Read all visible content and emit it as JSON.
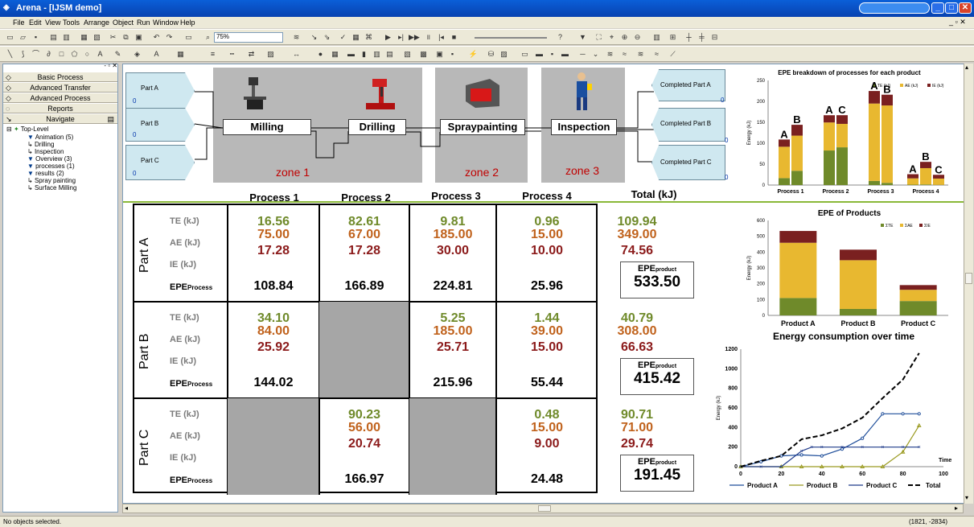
{
  "window": {
    "title": "Arena - [IJSM demo]"
  },
  "menu": [
    "File",
    "Edit",
    "View",
    "Tools",
    "Arrange",
    "Object",
    "Run",
    "Window",
    "Help"
  ],
  "toolbar": {
    "zoom": "75%"
  },
  "panels": [
    "Basic Process",
    "Advanced Transfer",
    "Advanced Process",
    "Reports",
    "Navigate"
  ],
  "tree": {
    "root": "Top-Level",
    "items": [
      "Animation (5)",
      "Drilling",
      "Inspection",
      "Overview (3)",
      "processes (1)",
      "results (2)",
      "Spray painting",
      "Surface Milling"
    ]
  },
  "model": {
    "parts": [
      {
        "label": "Part A",
        "count": "0"
      },
      {
        "label": "Part B",
        "count": "0"
      },
      {
        "label": "Part C",
        "count": "0"
      }
    ],
    "completed": [
      {
        "label": "Completed Part A",
        "count": "0"
      },
      {
        "label": "Completed Part B",
        "count": "0"
      },
      {
        "label": "Completed Part C",
        "count": "0"
      }
    ],
    "processes": [
      "Milling",
      "Drilling",
      "Spraypainting",
      "Inspection"
    ],
    "zones": [
      "zone 1",
      "zone 2",
      "zone 3"
    ]
  },
  "table": {
    "headers": [
      "Process 1",
      "Process 2",
      "Process 3",
      "Process 4",
      "Total  (kJ)"
    ],
    "row_labels": [
      "TE (kJ)",
      "AE (kJ)",
      "IE (kJ)"
    ],
    "epe_process": "EPE",
    "epe_process_sub": "Process",
    "epe_product": "EPE",
    "epe_product_sub": "product",
    "parts": [
      {
        "name": "Part A",
        "te": [
          "16.56",
          "82.61",
          "9.81",
          "0.96"
        ],
        "ae": [
          "75.00",
          "67.00",
          "185.00",
          "15.00"
        ],
        "ie": [
          "17.28",
          "17.28",
          "30.00",
          "10.00"
        ],
        "epe": [
          "108.84",
          "166.89",
          "224.81",
          "25.96"
        ],
        "total_te": "109.94",
        "total_ae": "349.00",
        "total_ie": "74.56",
        "total_epe": "533.50"
      },
      {
        "name": "Part B",
        "te": [
          "34.10",
          "",
          "5.25",
          "1.44"
        ],
        "ae": [
          "84.00",
          "",
          "185.00",
          "39.00"
        ],
        "ie": [
          "25.92",
          "",
          "25.71",
          "15.00"
        ],
        "epe": [
          "144.02",
          "",
          "215.96",
          "55.44"
        ],
        "total_te": "40.79",
        "total_ae": "308.00",
        "total_ie": "66.63",
        "total_epe": "415.42"
      },
      {
        "name": "Part C",
        "te": [
          "",
          "90.23",
          "",
          "0.48"
        ],
        "ae": [
          "",
          "56.00",
          "",
          "15.00"
        ],
        "ie": [
          "",
          "20.74",
          "",
          "9.00"
        ],
        "epe": [
          "",
          "166.97",
          "",
          "24.48"
        ],
        "total_te": "90.71",
        "total_ae": "71.00",
        "total_ie": "29.74",
        "total_epe": "191.45"
      }
    ]
  },
  "colors": {
    "te": "#6f8a2a",
    "ae": "#e8b830",
    "ie": "#7a2020"
  },
  "chart_data": [
    {
      "type": "bar",
      "title": "EPE  breakdown of processes for each product",
      "categories": [
        "Process 1",
        "Process 2",
        "Process 3",
        "Process 4"
      ],
      "ylabel": "Energy (kJ)",
      "ylim": [
        0,
        250
      ],
      "yticks": [
        0,
        50,
        100,
        150,
        200,
        250
      ],
      "legend": [
        "TE (kJ)",
        "AE (kJ)",
        "IE (kJ)"
      ],
      "groups": [
        {
          "letters": [
            "A",
            "B"
          ],
          "bars": [
            {
              "te": 16.56,
              "ae": 75.0,
              "ie": 17.28
            },
            {
              "te": 34.1,
              "ae": 84.0,
              "ie": 25.92
            }
          ]
        },
        {
          "letters": [
            "A",
            "C"
          ],
          "bars": [
            {
              "te": 82.61,
              "ae": 67.0,
              "ie": 17.28
            },
            {
              "te": 90.23,
              "ae": 56.0,
              "ie": 20.74
            }
          ]
        },
        {
          "letters": [
            "A",
            "B"
          ],
          "bars": [
            {
              "te": 9.81,
              "ae": 185.0,
              "ie": 30.0
            },
            {
              "te": 5.25,
              "ae": 185.0,
              "ie": 25.71
            }
          ]
        },
        {
          "letters": [
            "A",
            "B",
            "C"
          ],
          "bars": [
            {
              "te": 0.96,
              "ae": 15.0,
              "ie": 10.0
            },
            {
              "te": 1.44,
              "ae": 39.0,
              "ie": 15.0
            },
            {
              "te": 0.48,
              "ae": 15.0,
              "ie": 9.0
            }
          ]
        }
      ]
    },
    {
      "type": "bar",
      "title": "EPE of Products",
      "categories": [
        "Product A",
        "Product B",
        "Product C"
      ],
      "ylabel": "Energy (kJ)",
      "ylim": [
        0,
        600
      ],
      "yticks": [
        0,
        100,
        200,
        300,
        400,
        500,
        600
      ],
      "legend": [
        "ΣTE",
        "ΣAE",
        "ΣIE"
      ],
      "series": [
        {
          "name": "ΣTE",
          "values": [
            109.94,
            40.79,
            90.71
          ]
        },
        {
          "name": "ΣAE",
          "values": [
            349.0,
            308.0,
            71.0
          ]
        },
        {
          "name": "ΣIE",
          "values": [
            74.56,
            66.63,
            29.74
          ]
        }
      ]
    },
    {
      "type": "line",
      "title": "Energy consumption over time",
      "xlabel": "Time",
      "ylabel": "Energy (kJ)",
      "xlim": [
        0,
        100
      ],
      "ylim": [
        0,
        1200
      ],
      "xticks": [
        0,
        20,
        40,
        60,
        80,
        100
      ],
      "yticks": [
        0,
        200,
        400,
        600,
        800,
        1000,
        1200
      ],
      "series": [
        {
          "name": "Product A",
          "x": [
            0,
            10,
            20,
            30,
            40,
            50,
            60,
            70,
            80,
            88
          ],
          "y": [
            0,
            50,
            110,
            120,
            110,
            180,
            290,
            540,
            540,
            540
          ]
        },
        {
          "name": "Product B",
          "x": [
            0,
            20,
            30,
            40,
            50,
            60,
            70,
            80,
            88
          ],
          "y": [
            0,
            0,
            0,
            0,
            0,
            0,
            0,
            150,
            420
          ]
        },
        {
          "name": "Product C",
          "x": [
            0,
            10,
            20,
            30,
            35,
            40,
            50,
            60,
            70,
            80,
            88
          ],
          "y": [
            0,
            0,
            0,
            160,
            200,
            200,
            200,
            200,
            200,
            200,
            200
          ]
        },
        {
          "name": "Total",
          "x": [
            0,
            10,
            20,
            30,
            40,
            50,
            60,
            70,
            80,
            88
          ],
          "y": [
            0,
            60,
            110,
            280,
            320,
            390,
            500,
            700,
            890,
            1160
          ]
        }
      ]
    }
  ],
  "status": {
    "left": "No objects selected.",
    "coords": "(1821, -2834)"
  }
}
